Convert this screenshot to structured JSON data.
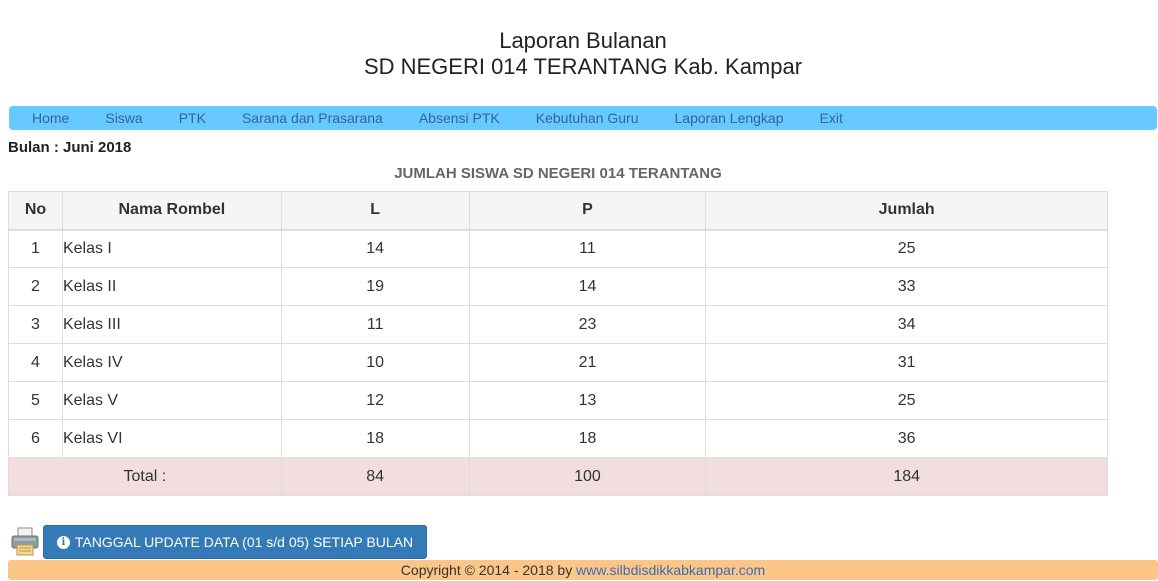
{
  "header": {
    "title_line1": "Laporan Bulanan",
    "title_line2": "SD NEGERI 014 TERANTANG Kab. Kampar"
  },
  "nav": {
    "items": [
      {
        "label": "Home"
      },
      {
        "label": "Siswa"
      },
      {
        "label": "PTK"
      },
      {
        "label": "Sarana dan Prasarana"
      },
      {
        "label": "Absensi PTK"
      },
      {
        "label": "Kebutuhan Guru"
      },
      {
        "label": "Laporan Lengkap"
      },
      {
        "label": "Exit"
      }
    ],
    "bg_color": "#66c9ff"
  },
  "bulan_label": "Bulan : Juni 2018",
  "table": {
    "title": "JUMLAH SISWA SD NEGERI 014 TERANTANG",
    "headers": [
      "No",
      "Nama Rombel",
      "L",
      "P",
      "Jumlah"
    ],
    "rows": [
      [
        "1",
        "Kelas I",
        "14",
        "11",
        "25"
      ],
      [
        "2",
        "Kelas II",
        "19",
        "14",
        "33"
      ],
      [
        "3",
        "Kelas III",
        "11",
        "23",
        "34"
      ],
      [
        "4",
        "Kelas IV",
        "10",
        "21",
        "31"
      ],
      [
        "5",
        "Kelas V",
        "12",
        "13",
        "25"
      ],
      [
        "6",
        "Kelas VI",
        "18",
        "18",
        "36"
      ]
    ],
    "total": {
      "label": "Total :",
      "l": "84",
      "p": "100",
      "jumlah": "184"
    }
  },
  "actions": {
    "printer_icon": "printer-icon",
    "update_button_label": "TANGGAL UPDATE DATA (01 s/d 05) SETIAP BULAN",
    "info_icon": "info-icon",
    "button_color": "#337ab7"
  },
  "footer": {
    "copyright_text": "Copyright © 2014 - 2018 by ",
    "link_text": "www.silbdisdikkabkampar.com",
    "bg_color": "#fcc688"
  }
}
